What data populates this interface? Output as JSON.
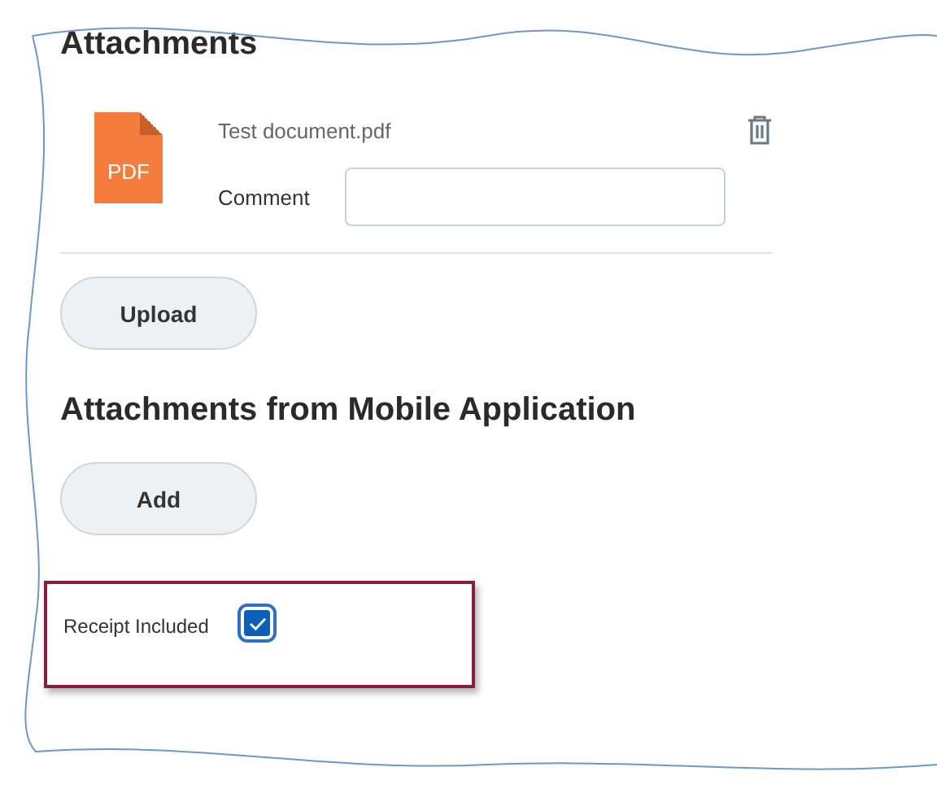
{
  "file_section": {
    "title": "Attachments",
    "files": [
      {
        "name": "Test document.pdf",
        "icon_label": "PDF",
        "comment_label": "Comment"
      }
    ],
    "button": "Upload"
  },
  "mobile_section": {
    "title": "Attachments from Mobile Application",
    "button": "Add"
  },
  "receipt": {
    "label": "Receipt Included",
    "checked": true
  }
}
